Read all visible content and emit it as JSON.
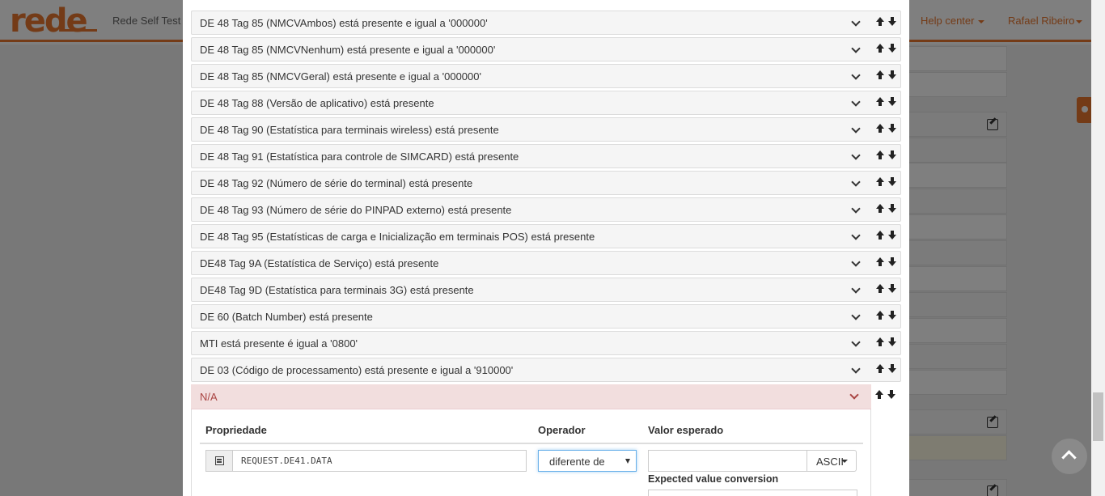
{
  "navbar": {
    "logo_text": "rede",
    "app_title": "Rede Self Test P",
    "help_label": "Help center",
    "user_label": "Rafael Ribeiro"
  },
  "rules": [
    {
      "label": "DE 48 Tag 85 (NMCVAmbos) está presente e igual a '000000'"
    },
    {
      "label": "DE 48 Tag 85 (NMCVNenhum) está presente e igual a '000000'"
    },
    {
      "label": "DE 48 Tag 85 (NMCVGeral) está presente e igual a '000000'"
    },
    {
      "label": "DE 48 Tag 88 (Versão de aplicativo) está presente"
    },
    {
      "label": "DE 48 Tag 90 (Estatística para terminais wireless) está presente"
    },
    {
      "label": "DE 48 Tag 91 (Estatística para controle de SIMCARD) está presente"
    },
    {
      "label": "DE 48 Tag 92 (Número de série do terminal) está presente"
    },
    {
      "label": "DE 48 Tag 93 (Número de série do PINPAD externo) está presente"
    },
    {
      "label": "DE 48 Tag 95 (Estatísticas de carga e Inicialização em terminais POS) está presente"
    },
    {
      "label": "DE48 Tag 9A (Estatística de Serviço) está presente"
    },
    {
      "label": "DE48 Tag 9D (Estatística para terminais 3G) está presente"
    },
    {
      "label": "DE 60 (Batch Number) está presente"
    },
    {
      "label": "MTI está presente é igual a '0800'"
    },
    {
      "label": "DE 03 (Código de processamento) está presente e igual a '910000'"
    }
  ],
  "active_rule": {
    "label": "N/A",
    "headers": {
      "property": "Propriedade",
      "operator": "Operador",
      "expected": "Valor esperado"
    },
    "property_value": "REQUEST.DE41.DATA",
    "operator_value": "diferente de",
    "expected_value": "",
    "encoding_value": "ASCII",
    "conversion_label": "Expected value conversion"
  },
  "colors": {
    "brand": "#e8772e",
    "danger_bg": "#f2dede",
    "danger_text": "#a94442"
  }
}
